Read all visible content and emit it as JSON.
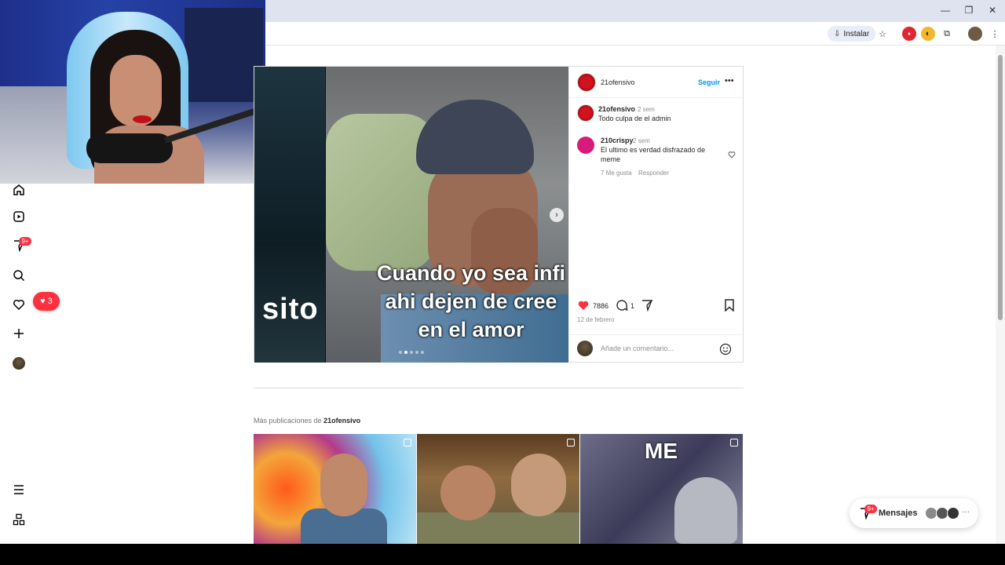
{
  "browser": {
    "install_label": "Instalar",
    "window_controls": [
      "—",
      "❐",
      "✕"
    ]
  },
  "nav": {
    "notification_count": "3",
    "messages_badge": "9+",
    "icons": [
      "home-icon",
      "reels-icon",
      "messenger-icon",
      "search-icon",
      "heart-icon",
      "create-icon",
      "profile-avatar",
      "menu-icon",
      "threads-icon"
    ]
  },
  "post": {
    "author": "21ofensivo",
    "follow_label": "Seguir",
    "more_label": "•••",
    "slide_prev_text": "sito",
    "caption_lines": [
      "Cuando yo sea infi",
      "ahi  dejen de cree",
      "en el amor"
    ],
    "comments": [
      {
        "user": "21ofensivo",
        "time": "2 sem",
        "text": "Todo culpa de el admin"
      },
      {
        "user": "210crispy",
        "time": "2 sem",
        "text_line1": "El ultimo es verdad disfrazado de",
        "text_line2": "meme",
        "likes": "7 Me gusta",
        "reply": "Responder"
      }
    ],
    "like_count": "7886",
    "comment_count": "1",
    "date": "12 de febrero",
    "comment_placeholder": "Añade un comentario..."
  },
  "more_posts": {
    "prefix": "Más publicaciones de ",
    "author": "21ofensivo",
    "thumb3_text": "ME"
  },
  "messages": {
    "label": "Mensajes",
    "badge": "9+",
    "more": "···"
  },
  "colors": {
    "like_red": "#ff3040",
    "follow_blue": "#0095f6"
  }
}
